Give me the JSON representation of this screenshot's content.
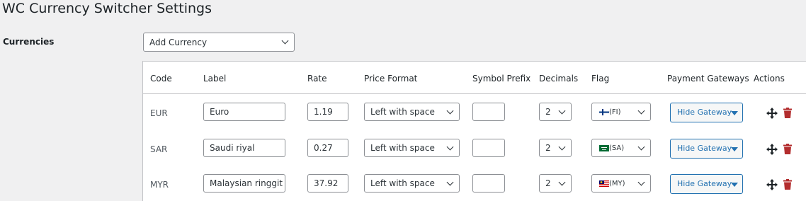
{
  "page": {
    "title": "WC Currency Switcher Settings"
  },
  "currencies": {
    "label": "Currencies",
    "add_select": "Add Currency"
  },
  "table": {
    "headers": {
      "code": "Code",
      "label": "Label",
      "rate": "Rate",
      "price_format": "Price Format",
      "symbol_prefix": "Symbol Prefix",
      "decimals": "Decimals",
      "flag": "Flag",
      "payment_gateways": "Payment Gateways",
      "actions": "Actions"
    },
    "rows": [
      {
        "code": "EUR",
        "label": "Euro",
        "rate": "1.19",
        "price_format": "Left with space",
        "symbol_prefix": "",
        "decimals": "2",
        "flag": "(FI)",
        "gateway_button": "Hide Gateway",
        "flag_icon": "finland-flag-icon"
      },
      {
        "code": "SAR",
        "label": "Saudi riyal",
        "rate": "0.27",
        "price_format": "Left with space",
        "symbol_prefix": "",
        "decimals": "2",
        "flag": "(SA)",
        "gateway_button": "Hide Gateway",
        "flag_icon": "saudi-arabia-flag-icon"
      },
      {
        "code": "MYR",
        "label": "Malaysian ringgit",
        "rate": "37.92",
        "price_format": "Left with space",
        "symbol_prefix": "",
        "decimals": "2",
        "flag": "(MY)",
        "gateway_button": "Hide Gateway",
        "flag_icon": "malaysia-flag-icon"
      }
    ]
  },
  "colors": {
    "accent": "#2271b1",
    "delete": "#b32d2e",
    "background": "#f0f0f1"
  }
}
